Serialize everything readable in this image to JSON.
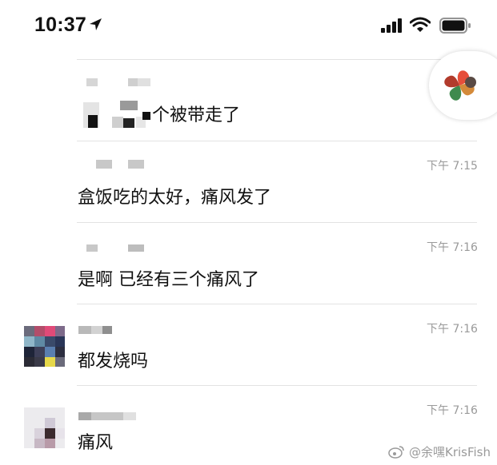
{
  "status_bar": {
    "time": "10:37"
  },
  "messages": [
    {
      "text": "这个被带走了",
      "visible_text": "个被带走了",
      "time": ""
    },
    {
      "text": "盒饭吃的太好，痛风发了",
      "time": "下午 7:15"
    },
    {
      "text": "是啊 已经有三个痛风了",
      "time": "下午 7:16"
    },
    {
      "text": "都发烧吗",
      "time": "下午 7:16"
    },
    {
      "text": "痛风",
      "time": "下午 7:16"
    }
  ],
  "watermark": {
    "text": "@余嘿KrisFish"
  },
  "colors": {
    "divider": "#e3e3e3",
    "time_text": "#9a9a9a",
    "message_text": "#111111"
  },
  "icons": [
    "location-arrow-icon",
    "signal-icon",
    "wifi-icon",
    "battery-icon",
    "floating-app-icon",
    "weibo-icon"
  ]
}
